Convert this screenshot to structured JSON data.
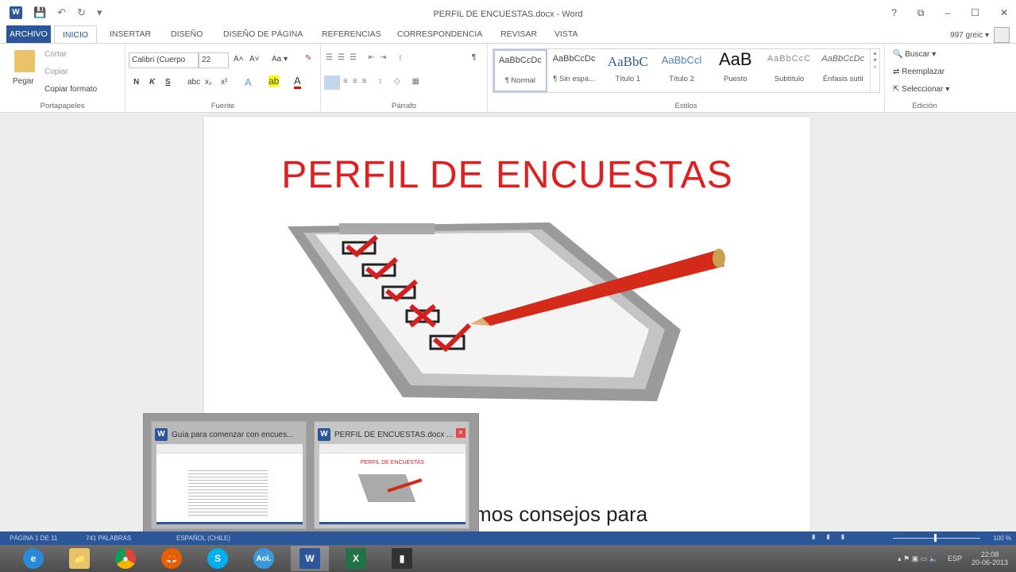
{
  "window": {
    "title": "PERFIL DE ENCUESTAS.docx - Word",
    "help": "?",
    "restore_ribbon": "⧉",
    "minimize": "–",
    "maximize": "☐",
    "close": "✕"
  },
  "qat": {
    "undo": "↶",
    "redo": "↻",
    "more": "▾"
  },
  "tabs": [
    "ARCHIVO",
    "INICIO",
    "INSERTAR",
    "DISEÑO",
    "DISEÑO DE PÁGINA",
    "REFERENCIAS",
    "CORRESPONDENCIA",
    "REVISAR",
    "VISTA"
  ],
  "user": "997 greic ▾",
  "clipboard": {
    "paste": "Pegar",
    "cut": "Cortar",
    "copy": "Copiar",
    "format_painter": "Copiar formato",
    "label": "Portapapeles"
  },
  "font": {
    "name": "Calibri (Cuerpo",
    "size": "22",
    "grow": "A˄",
    "shrink": "A˅",
    "case": "Aa ▾",
    "bold": "N",
    "italic": "K",
    "underline": "S",
    "strike": "abc",
    "sub": "x₂",
    "sup": "x²",
    "label": "Fuente"
  },
  "paragraph": {
    "label": "Párrafo",
    "pilcrow": "¶"
  },
  "styles": {
    "label": "Estilos",
    "items": [
      {
        "sample": "AaBbCcDc",
        "name": "¶ Normal"
      },
      {
        "sample": "AaBbCcDc",
        "name": "¶ Sin espa..."
      },
      {
        "sample": "AaBbC",
        "name": "Título 1"
      },
      {
        "sample": "AaBbCcl",
        "name": "Título 2"
      },
      {
        "sample": "AaB",
        "name": "Puesto"
      },
      {
        "sample": "AaBbCcC",
        "name": "Subtítulo"
      },
      {
        "sample": "AaBbCcDc",
        "name": "Énfasis sutil"
      }
    ]
  },
  "editing": {
    "find": "Buscar ▾",
    "replace": "Reemplazar",
    "select": "Seleccionar ▾",
    "label": "Edición"
  },
  "document": {
    "title": "PERFIL DE ENCUESTAS",
    "body_partial": "mos consejos para"
  },
  "thumbnails": [
    {
      "title": "Guía para comenzar con encues...",
      "preview_title": ""
    },
    {
      "title": "PERFIL DE ENCUESTAS.docx ...",
      "preview_title": "PERFIL DE ENCUESTAS"
    }
  ],
  "status": {
    "page": "PÁGINA 1 DE 11",
    "words": "741 PALABRAS",
    "lang": "ESPAÑOL (CHILE)",
    "zoom": "100 %",
    "zoom_value": 100
  },
  "taskbar": {
    "apps": [
      "e",
      "📁",
      "●",
      "🦊",
      "S",
      "Aol.",
      "W",
      "X",
      "▮"
    ],
    "lang": "ESP",
    "time": "22:08",
    "date": "20-06-2013"
  }
}
